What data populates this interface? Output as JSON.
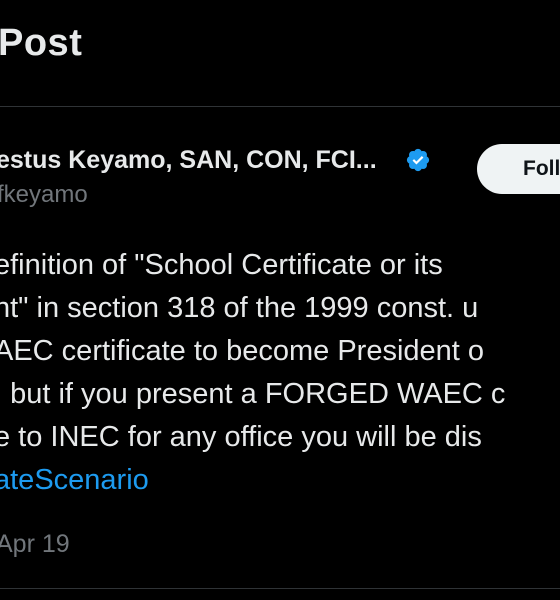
{
  "header": {
    "title": "Post"
  },
  "author": {
    "name": "estus Keyamo, SAN, CON, FCI...",
    "handle": "fkeyamo",
    "verified": true,
    "verified_icon": "verified-badge-icon",
    "verified_color": "#1d9bf0"
  },
  "follow_button": {
    "label": "Follow"
  },
  "post": {
    "lines": [
      "efinition of \"School Certificate or its",
      "nt\" in section 318 of the 1999 const. u",
      "AEC certificate to become President o",
      ", but if you present a FORGED WAEC c",
      "e to INEC for any office you will be dis"
    ],
    "hashtag": "ateScenario",
    "timestamp": "Apr 19"
  },
  "colors": {
    "background": "#000000",
    "text": "#e7e9ea",
    "secondary": "#71767b",
    "link": "#1d9bf0",
    "divider": "#2f3336"
  }
}
